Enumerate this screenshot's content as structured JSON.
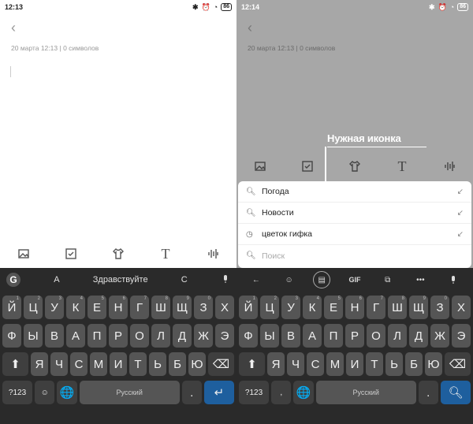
{
  "left": {
    "status": {
      "time": "12:13",
      "battery": "86"
    },
    "note": {
      "date": "20 марта",
      "time": "12:13",
      "chars": "0 символов"
    },
    "suggestions": [
      "A",
      "Здравствуйте",
      "C"
    ],
    "space_label": "Русский",
    "symbols_label": "?123"
  },
  "right": {
    "status": {
      "time": "12:14",
      "battery": "86"
    },
    "note": {
      "date": "20 марта",
      "time": "12:13",
      "chars": "0 символов"
    },
    "annotation": "Нужная иконка",
    "search_results": [
      {
        "icon": "search-icon",
        "text": "Погода"
      },
      {
        "icon": "search-icon",
        "text": "Новости"
      },
      {
        "icon": "history-icon",
        "text": "цветок гифка"
      }
    ],
    "search_placeholder": "Поиск",
    "tools": {
      "gif": "GIF",
      "more": "•••"
    },
    "space_label": "Русский",
    "symbols_label": "?123"
  },
  "keyboard": {
    "row1": [
      "Й",
      "Ц",
      "У",
      "К",
      "Е",
      "Н",
      "Г",
      "Ш",
      "Щ",
      "З",
      "Х"
    ],
    "row1_hints": [
      "1",
      "2",
      "3",
      "4",
      "5",
      "6",
      "7",
      "8",
      "9",
      "0",
      ""
    ],
    "row2": [
      "Ф",
      "Ы",
      "В",
      "А",
      "П",
      "Р",
      "О",
      "Л",
      "Д",
      "Ж",
      "Э"
    ],
    "row3": [
      "Я",
      "Ч",
      "С",
      "М",
      "И",
      "Т",
      "Ь",
      "Б",
      "Ю"
    ]
  },
  "colors": {
    "dim_background": "#a7a7a7",
    "keyboard_bg": "#2a2a2a",
    "key_bg": "#555555",
    "action_key": "#1e5f9e"
  }
}
